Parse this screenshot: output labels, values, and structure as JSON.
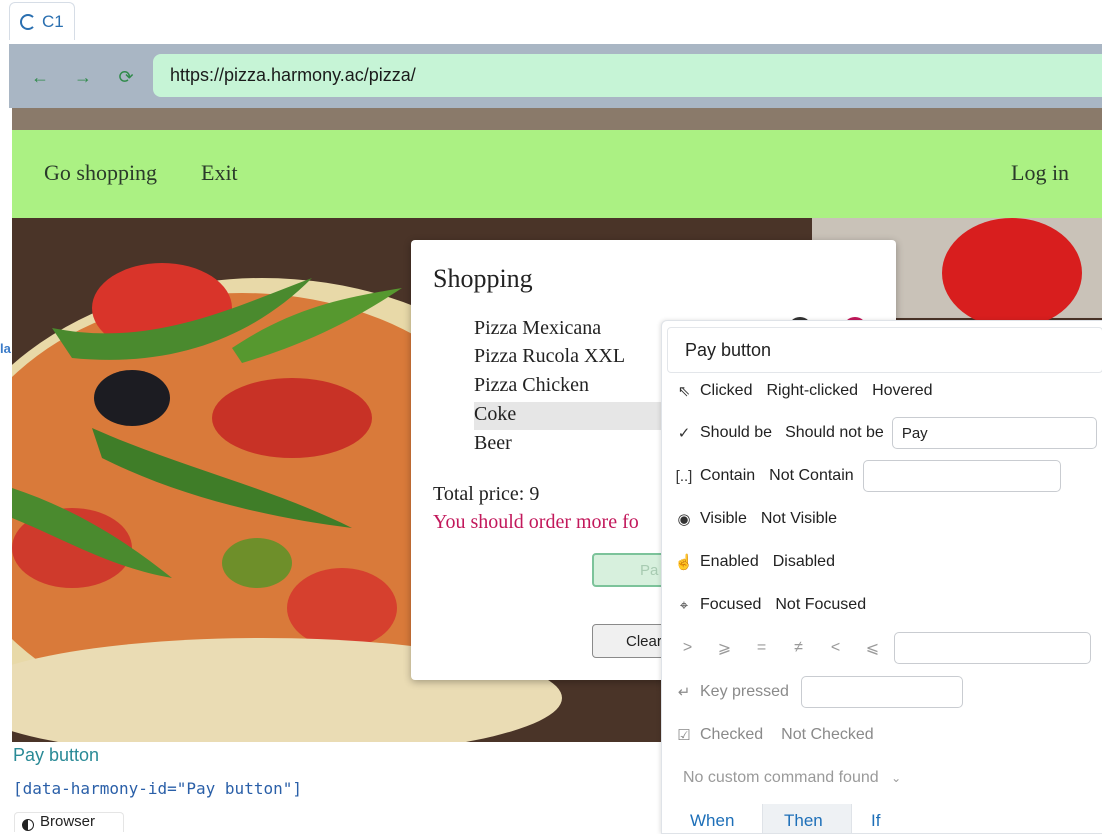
{
  "tab": {
    "label": "C1"
  },
  "left_mark": "la",
  "browser": {
    "url": "https://pizza.harmony.ac/pizza/",
    "back_icon": "arrow-left-icon",
    "forward_icon": "arrow-right-icon",
    "reload_icon": "reload-icon"
  },
  "nav": {
    "shopping": "Go shopping",
    "exit": "Exit",
    "login": "Log in"
  },
  "dialog": {
    "title": "Shopping",
    "items": [
      "Pizza Mexicana",
      "Pizza Rucola XXL",
      "Pizza Chicken",
      "Coke",
      "Beer"
    ],
    "total": "Total price: 9",
    "warning": "You should order more fo",
    "pay": "Pa",
    "clear": "Clear"
  },
  "selection": {
    "name": "Pay button",
    "selector": "[data-harmony-id=\"Pay button\"]",
    "browser_tab": "Browser"
  },
  "panel": {
    "title": "Pay button",
    "rows": {
      "mouse": [
        "Clicked",
        "Right-clicked",
        "Hovered"
      ],
      "should": [
        "Should be",
        "Should not be"
      ],
      "should_value": "Pay",
      "contain": [
        "Contain",
        "Not Contain"
      ],
      "visible": [
        "Visible",
        "Not Visible"
      ],
      "enabled": [
        "Enabled",
        "Disabled"
      ],
      "focused": [
        "Focused",
        "Not Focused"
      ],
      "compare": [
        ">",
        "⩾",
        "=",
        "≠",
        "<",
        "⩽"
      ],
      "key": "Key pressed",
      "checked": [
        "Checked",
        "Not Checked"
      ]
    },
    "custom": "No custom command found",
    "tabs": [
      "When",
      "Then",
      "If"
    ]
  },
  "colors": {
    "nav_green": "#abf183",
    "url_bg": "#c6f4d6",
    "warning": "#c2185b",
    "link_blue": "#1d6fb8"
  }
}
